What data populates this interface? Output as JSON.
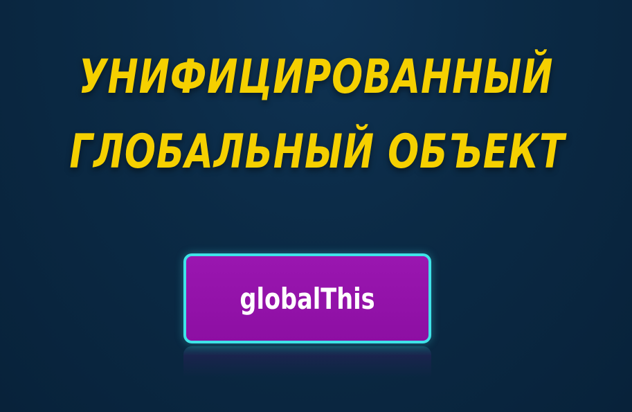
{
  "title": {
    "line1": "УНИФИЦИРОВАННЫЙ",
    "line2": "ГЛОБАЛЬНЫЙ ОБЪЕКТ"
  },
  "button": {
    "label": "globalThis"
  },
  "colors": {
    "background": "#0b2a45",
    "title": "#f5d000",
    "button_fill": "#8d0fa3",
    "button_border": "#3fe3e8",
    "button_text": "#ffffff"
  }
}
